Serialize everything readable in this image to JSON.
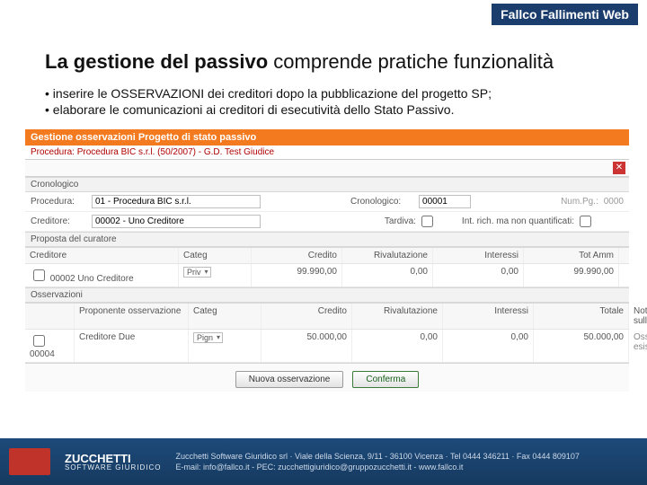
{
  "topband": "Fallco Fallimenti Web",
  "title_bold": "La gestione del passivo",
  "title_rest": " comprende pratiche funzionalità",
  "bullets": [
    "inserire le OSSERVAZIONI dei creditori dopo la pubblicazione del progetto SP;",
    "elaborare le comunicazioni ai creditori di esecutività dello Stato Passivo."
  ],
  "shot": {
    "header": "Gestione osservazioni Progetto di stato passivo",
    "procline": "Procedura: Procedura BIC s.r.l. (50/2007) - G.D. Test Giudice",
    "sec_cron": "Cronologico",
    "lbl_proc": "Procedura:",
    "val_proc": "01 - Procedura BIC s.r.l.",
    "lbl_cron": "Cronologico:",
    "val_cron": "00001",
    "lbl_num": "Num.Pg.:",
    "val_num": "0000",
    "lbl_cred": "Creditore:",
    "val_cred": "00002 - Uno Creditore",
    "lbl_tard": "Tardiva:",
    "lbl_int": "Int. rich. ma non quantificati:",
    "sec_prop": "Proposta del curatore",
    "cols": {
      "cred": "Creditore",
      "cat": "Categ",
      "credito": "Credito",
      "riv": "Rivalutazione",
      "int": "Interessi",
      "tot": "Tot Amm"
    },
    "row1": {
      "chk": "00002",
      "name": "Uno Creditore",
      "cat": "Priv",
      "credito": "99.990,00",
      "riv": "0,00",
      "int": "0,00",
      "tot": "99.990,00"
    },
    "sec_oss": "Osservazioni",
    "cols2": {
      "prop": "Proponente osservazione",
      "cat": "Categ",
      "credito": "Credito",
      "riv": "Rivalutazione",
      "int": "Interessi",
      "tot": "Totale",
      "note": "Note de curatore sull'osservazione"
    },
    "row2": {
      "chk": "00004",
      "name": "Creditore Due",
      "cat": "Pign",
      "credito": "50.000,00",
      "riv": "0,00",
      "int": "0,00",
      "tot": "50.000,00",
      "note": "Osservazione esistente"
    },
    "btn_new": "Nuova osservazione",
    "btn_conf": "Conferma"
  },
  "footer": {
    "brand": "ZUCCHETTI",
    "brand_sub": "SOFTWARE GIURIDICO",
    "line1": "Zucchetti Software Giuridico srl · Viale della Scienza, 9/11 - 36100 Vicenza · Tel 0444 346211 · Fax 0444 809107",
    "line2": "E-mail: info@fallco.it - PEC: zucchettigiuridico@gruppozucchetti.it - www.fallco.it"
  }
}
